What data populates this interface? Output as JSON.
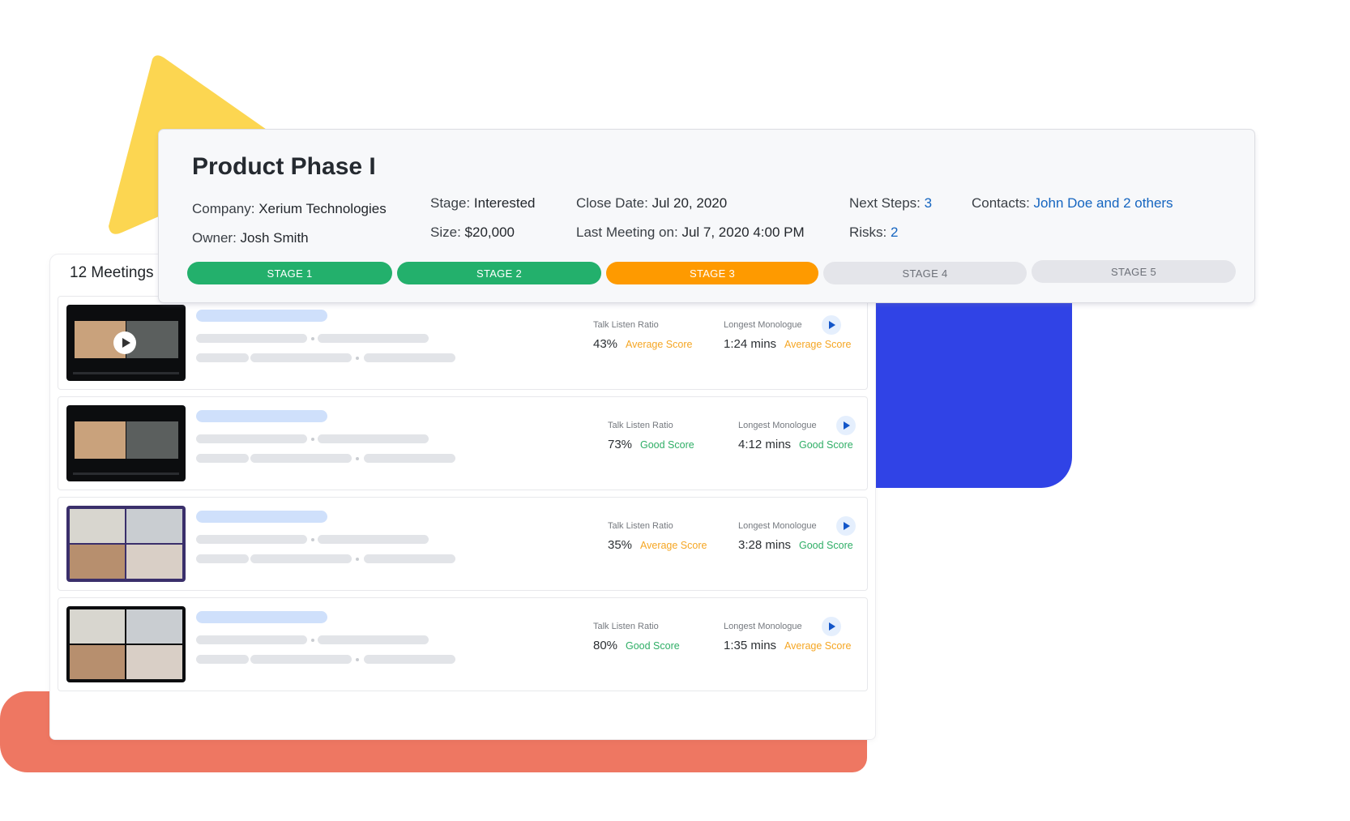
{
  "colors": {
    "stage_done": "#23b06c",
    "stage_current": "#fe9a00",
    "stage_todo": "#e4e5ea",
    "link": "#1565c0",
    "score_average": "#f5a623",
    "score_good": "#2fae66",
    "deco_yellow": "#fcd651",
    "deco_blue": "#3043e6",
    "deco_coral": "#ee7762"
  },
  "opportunity": {
    "title": "Product Phase I",
    "company_label": "Company:",
    "company": "Xerium Technologies",
    "owner_label": "Owner:",
    "owner": "Josh Smith",
    "stage_label": "Stage:",
    "stage": "Interested",
    "size_label": "Size:",
    "size": "$20,000",
    "close_date_label": "Close Date:",
    "close_date": "Jul 20, 2020",
    "last_meeting_label": "Last Meeting on:",
    "last_meeting": "Jul 7, 2020 4:00 PM",
    "next_steps_label": "Next Steps:",
    "next_steps": "3",
    "risks_label": "Risks:",
    "risks": "2",
    "contacts_label": "Contacts:",
    "contacts": "John Doe and 2 others",
    "stages": [
      {
        "label": "STAGE 1",
        "status": "done"
      },
      {
        "label": "STAGE 2",
        "status": "done"
      },
      {
        "label": "STAGE 3",
        "status": "current"
      },
      {
        "label": "STAGE 4",
        "status": "todo"
      },
      {
        "label": "STAGE 5",
        "status": "todo"
      }
    ]
  },
  "meetings": {
    "title": "12 Meetings",
    "talk_label": "Talk Listen Ratio",
    "monologue_label": "Longest Monologue",
    "items": [
      {
        "thumbnail": "video-call-2-people",
        "has_play_overlay": true,
        "talk_ratio": "43%",
        "talk_score": "Average Score",
        "talk_score_type": "average",
        "monologue": "1:24 mins",
        "monologue_score": "Average Score",
        "monologue_score_type": "average"
      },
      {
        "thumbnail": "video-call-2-people",
        "has_play_overlay": false,
        "talk_ratio": "73%",
        "talk_score": "Good Score",
        "talk_score_type": "good",
        "monologue": "4:12 mins",
        "monologue_score": "Good Score",
        "monologue_score_type": "good"
      },
      {
        "thumbnail": "video-call-4-people",
        "has_play_overlay": false,
        "talk_ratio": "35%",
        "talk_score": "Average Score",
        "talk_score_type": "average",
        "monologue": "3:28 mins",
        "monologue_score": "Good Score",
        "monologue_score_type": "good"
      },
      {
        "thumbnail": "video-call-4-people",
        "has_play_overlay": false,
        "talk_ratio": "80%",
        "talk_score": "Good Score",
        "talk_score_type": "good",
        "monologue": "1:35 mins",
        "monologue_score": "Average Score",
        "monologue_score_type": "average"
      }
    ]
  }
}
